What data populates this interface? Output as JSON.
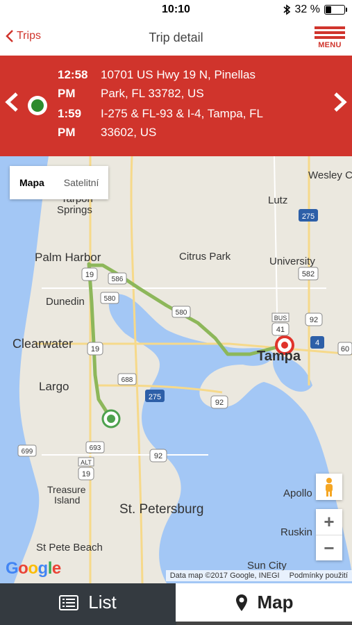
{
  "status": {
    "time": "10:10",
    "battery": "32 %",
    "battery_level": 0.32,
    "bluetooth_icon": "bluetooth-icon"
  },
  "nav": {
    "back_label": "Trips",
    "title": "Trip detail",
    "menu_label": "MENU"
  },
  "trip": {
    "start_time_1": "12:58",
    "start_time_2": "PM",
    "start_addr_1": "10701 US Hwy 19 N, Pinellas",
    "start_addr_2": "Park, FL 33782, US",
    "end_time_1": "1:59",
    "end_time_2": "PM",
    "end_addr_1": "I-275 & FL-93 & I-4, Tampa, FL",
    "end_addr_2": "33602, US"
  },
  "map": {
    "toggle_map": "Mapa",
    "toggle_satellite": "Satelitní",
    "zoom_in": "+",
    "zoom_out": "−",
    "google": "Google",
    "attribution": "Data map ©2017 Google, INEGI",
    "terms": "Podmínky použití",
    "places": {
      "tarpon": "Tarpon",
      "springs": "Springs",
      "wesley": "Wesley C",
      "lutz": "Lutz",
      "palm_harbor": "Palm Harbor",
      "citrus_park": "Citrus Park",
      "university": "University",
      "dunedin": "Dunedin",
      "clearwater": "Clearwater",
      "tampa": "Tampa",
      "largo": "Largo",
      "treasure": "Treasure",
      "island": "Island",
      "st_petersburg": "St. Petersburg",
      "apollo": "Apollo",
      "ruskin": "Ruskin",
      "st_pete_beach": "St Pete Beach",
      "sun_city": "Sun City"
    },
    "shields": {
      "i275_n": "275",
      "r582": "582",
      "r19a": "19",
      "r586": "586",
      "r580a": "580",
      "r580b": "580",
      "bus": "BUS",
      "r41": "41",
      "r92a": "92",
      "i4": "4",
      "r60": "60",
      "r19b": "19",
      "r688": "688",
      "i275_s": "275",
      "r92b": "92",
      "r693": "693",
      "r699": "699",
      "alt": "ALT",
      "r19c": "19",
      "r92c": "92"
    }
  },
  "tabs": {
    "list_label": "List",
    "map_label": "Map"
  },
  "colors": {
    "accent": "#d0342c",
    "route": "#8db75a",
    "tab_dark": "#343a40",
    "water": "#a3c7f5"
  }
}
